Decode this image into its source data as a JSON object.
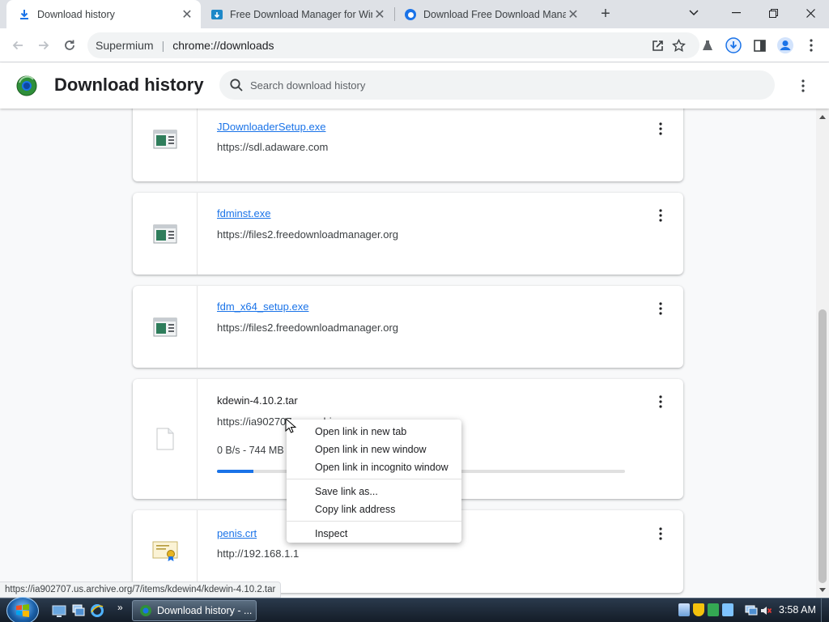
{
  "tabs": [
    {
      "title": "Download history",
      "active": true,
      "icon": "download-icon"
    },
    {
      "title": "Free Download Manager for Win",
      "active": false,
      "icon": "fdm-icon"
    },
    {
      "title": "Download Free Download Mana",
      "active": false,
      "icon": "edge-icon"
    }
  ],
  "toolbar": {
    "site_name": "Supermium",
    "separator": "|",
    "url": "chrome://downloads"
  },
  "downloads_page": {
    "title": "Download history",
    "search_placeholder": "Search download history"
  },
  "downloads": [
    {
      "filename": "JDownloaderSetup.exe",
      "source": "https://sdl.adaware.com",
      "link": true,
      "icon": "exe-icon"
    },
    {
      "filename": "fdminst.exe",
      "source": "https://files2.freedownloadmanager.org",
      "link": true,
      "icon": "exe-icon"
    },
    {
      "filename": "fdm_x64_setup.exe",
      "source": "https://files2.freedownloadmanager.org",
      "link": true,
      "icon": "exe-icon"
    },
    {
      "filename": "kdewin-4.10.2.tar",
      "source": "https://ia902707.us.archive.org",
      "link": false,
      "icon": "file-icon",
      "progress_text": "0 B/s - 744 MB",
      "progress": 0.09
    },
    {
      "filename": "penis.crt",
      "source": "http://192.168.1.1",
      "link": true,
      "icon": "certificate-icon"
    }
  ],
  "context_menu": {
    "group1": [
      "Open link in new tab",
      "Open link in new window",
      "Open link in incognito window"
    ],
    "group2": [
      "Save link as...",
      "Copy link address"
    ],
    "group3": [
      "Inspect"
    ]
  },
  "status_url": "https://ia902707.us.archive.org/7/items/kdewin4/kdewin-4.10.2.tar",
  "taskbar": {
    "window_label": "Download history - ...",
    "quicklaunch_more": "»",
    "clock": "3:58 AM"
  },
  "colors": {
    "accent": "#1a73e8",
    "tabstrip": "#dee1e6",
    "page_bg": "#f8f9fa"
  }
}
